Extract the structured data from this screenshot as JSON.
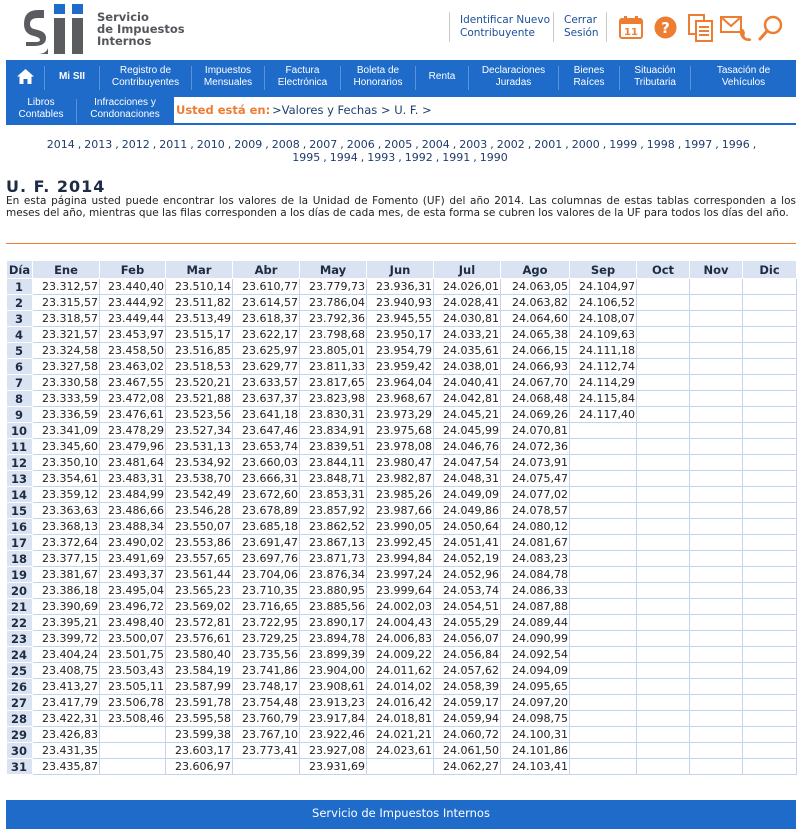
{
  "header": {
    "logo_name": "SII",
    "logo_text": [
      "Servicio",
      "de Impuestos",
      "Internos"
    ],
    "link_identify": [
      "Identificar Nuevo",
      "Contribuyente"
    ],
    "link_logout": [
      "Cerrar",
      "Sesión"
    ],
    "calendar_day": "11",
    "colors": {
      "brand_blue": "#1e6bc9",
      "accent_orange": "#ed7d31"
    }
  },
  "nav": {
    "home_icon": "home-icon",
    "items": [
      {
        "label": [
          "Mi SII"
        ]
      },
      {
        "label": [
          "Registro de",
          "Contribuyentes"
        ]
      },
      {
        "label": [
          "Impuestos",
          "Mensuales"
        ]
      },
      {
        "label": [
          "Factura",
          "Electrónica"
        ]
      },
      {
        "label": [
          "Boleta de",
          "Honorarios"
        ]
      },
      {
        "label": [
          "Renta"
        ]
      },
      {
        "label": [
          "Declaraciones",
          "Juradas"
        ]
      },
      {
        "label": [
          "Bienes",
          "Raíces"
        ]
      },
      {
        "label": [
          "Situación",
          "Tributaria"
        ]
      },
      {
        "label": [
          "Tasación de",
          "Vehículos"
        ]
      }
    ],
    "row2": [
      {
        "label": [
          "Libros",
          "Contables"
        ]
      },
      {
        "label": [
          "Infracciones y",
          "Condonaciones"
        ]
      }
    ]
  },
  "breadcrumb": {
    "label": "Usted está en:",
    "path": ">Valores y Fechas >  U. F. >"
  },
  "years": [
    "2014",
    "2013",
    "2012",
    "2011",
    "2010",
    "2009",
    "2008",
    "2007",
    "2006",
    "2005",
    "2004",
    "2003",
    "2002",
    "2001",
    "2000",
    "1999",
    "1998",
    "1997",
    "1996",
    "1995",
    "1994",
    "1993",
    "1992",
    "1991",
    "1990"
  ],
  "page": {
    "title": "U. F. 2014",
    "description": "En esta página usted puede encontrar los valores de la Unidad de Fomento (UF) del año 2014. Las columnas de estas tablas corresponden a los meses del año, mientras que las filas corresponden a los días de cada mes, de esta forma se cubren los valores de la UF para todos los días del año."
  },
  "table": {
    "headers": [
      "Día",
      "Ene",
      "Feb",
      "Mar",
      "Abr",
      "May",
      "Jun",
      "Jul",
      "Ago",
      "Sep",
      "Oct",
      "Nov",
      "Dic"
    ],
    "rows": [
      [
        "1",
        "23.312,57",
        "23.440,40",
        "23.510,14",
        "23.610,77",
        "23.779,73",
        "23.936,31",
        "24.026,01",
        "24.063,05",
        "24.104,97",
        "",
        "",
        ""
      ],
      [
        "2",
        "23.315,57",
        "23.444,92",
        "23.511,82",
        "23.614,57",
        "23.786,04",
        "23.940,93",
        "24.028,41",
        "24.063,82",
        "24.106,52",
        "",
        "",
        ""
      ],
      [
        "3",
        "23.318,57",
        "23.449,44",
        "23.513,49",
        "23.618,37",
        "23.792,36",
        "23.945,55",
        "24.030,81",
        "24.064,60",
        "24.108,07",
        "",
        "",
        ""
      ],
      [
        "4",
        "23.321,57",
        "23.453,97",
        "23.515,17",
        "23.622,17",
        "23.798,68",
        "23.950,17",
        "24.033,21",
        "24.065,38",
        "24.109,63",
        "",
        "",
        ""
      ],
      [
        "5",
        "23.324,58",
        "23.458,50",
        "23.516,85",
        "23.625,97",
        "23.805,01",
        "23.954,79",
        "24.035,61",
        "24.066,15",
        "24.111,18",
        "",
        "",
        ""
      ],
      [
        "6",
        "23.327,58",
        "23.463,02",
        "23.518,53",
        "23.629,77",
        "23.811,33",
        "23.959,42",
        "24.038,01",
        "24.066,93",
        "24.112,74",
        "",
        "",
        ""
      ],
      [
        "7",
        "23.330,58",
        "23.467,55",
        "23.520,21",
        "23.633,57",
        "23.817,65",
        "23.964,04",
        "24.040,41",
        "24.067,70",
        "24.114,29",
        "",
        "",
        ""
      ],
      [
        "8",
        "23.333,59",
        "23.472,08",
        "23.521,88",
        "23.637,37",
        "23.823,98",
        "23.968,67",
        "24.042,81",
        "24.068,48",
        "24.115,84",
        "",
        "",
        ""
      ],
      [
        "9",
        "23.336,59",
        "23.476,61",
        "23.523,56",
        "23.641,18",
        "23.830,31",
        "23.973,29",
        "24.045,21",
        "24.069,26",
        "24.117,40",
        "",
        "",
        ""
      ],
      [
        "10",
        "23.341,09",
        "23.478,29",
        "23.527,34",
        "23.647,46",
        "23.834,91",
        "23.975,68",
        "24.045,99",
        "24.070,81",
        "",
        "",
        "",
        ""
      ],
      [
        "11",
        "23.345,60",
        "23.479,96",
        "23.531,13",
        "23.653,74",
        "23.839,51",
        "23.978,08",
        "24.046,76",
        "24.072,36",
        "",
        "",
        "",
        ""
      ],
      [
        "12",
        "23.350,10",
        "23.481,64",
        "23.534,92",
        "23.660,03",
        "23.844,11",
        "23.980,47",
        "24.047,54",
        "24.073,91",
        "",
        "",
        "",
        ""
      ],
      [
        "13",
        "23.354,61",
        "23.483,31",
        "23.538,70",
        "23.666,31",
        "23.848,71",
        "23.982,87",
        "24.048,31",
        "24.075,47",
        "",
        "",
        "",
        ""
      ],
      [
        "14",
        "23.359,12",
        "23.484,99",
        "23.542,49",
        "23.672,60",
        "23.853,31",
        "23.985,26",
        "24.049,09",
        "24.077,02",
        "",
        "",
        "",
        ""
      ],
      [
        "15",
        "23.363,63",
        "23.486,66",
        "23.546,28",
        "23.678,89",
        "23.857,92",
        "23.987,66",
        "24.049,86",
        "24.078,57",
        "",
        "",
        "",
        ""
      ],
      [
        "16",
        "23.368,13",
        "23.488,34",
        "23.550,07",
        "23.685,18",
        "23.862,52",
        "23.990,05",
        "24.050,64",
        "24.080,12",
        "",
        "",
        "",
        ""
      ],
      [
        "17",
        "23.372,64",
        "23.490,02",
        "23.553,86",
        "23.691,47",
        "23.867,13",
        "23.992,45",
        "24.051,41",
        "24.081,67",
        "",
        "",
        "",
        ""
      ],
      [
        "18",
        "23.377,15",
        "23.491,69",
        "23.557,65",
        "23.697,76",
        "23.871,73",
        "23.994,84",
        "24.052,19",
        "24.083,23",
        "",
        "",
        "",
        ""
      ],
      [
        "19",
        "23.381,67",
        "23.493,37",
        "23.561,44",
        "23.704,06",
        "23.876,34",
        "23.997,24",
        "24.052,96",
        "24.084,78",
        "",
        "",
        "",
        ""
      ],
      [
        "20",
        "23.386,18",
        "23.495,04",
        "23.565,23",
        "23.710,35",
        "23.880,95",
        "23.999,64",
        "24.053,74",
        "24.086,33",
        "",
        "",
        "",
        ""
      ],
      [
        "21",
        "23.390,69",
        "23.496,72",
        "23.569,02",
        "23.716,65",
        "23.885,56",
        "24.002,03",
        "24.054,51",
        "24.087,88",
        "",
        "",
        "",
        ""
      ],
      [
        "22",
        "23.395,21",
        "23.498,40",
        "23.572,81",
        "23.722,95",
        "23.890,17",
        "24.004,43",
        "24.055,29",
        "24.089,44",
        "",
        "",
        "",
        ""
      ],
      [
        "23",
        "23.399,72",
        "23.500,07",
        "23.576,61",
        "23.729,25",
        "23.894,78",
        "24.006,83",
        "24.056,07",
        "24.090,99",
        "",
        "",
        "",
        ""
      ],
      [
        "24",
        "23.404,24",
        "23.501,75",
        "23.580,40",
        "23.735,56",
        "23.899,39",
        "24.009,22",
        "24.056,84",
        "24.092,54",
        "",
        "",
        "",
        ""
      ],
      [
        "25",
        "23.408,75",
        "23.503,43",
        "23.584,19",
        "23.741,86",
        "23.904,00",
        "24.011,62",
        "24.057,62",
        "24.094,09",
        "",
        "",
        "",
        ""
      ],
      [
        "26",
        "23.413,27",
        "23.505,11",
        "23.587,99",
        "23.748,17",
        "23.908,61",
        "24.014,02",
        "24.058,39",
        "24.095,65",
        "",
        "",
        "",
        ""
      ],
      [
        "27",
        "23.417,79",
        "23.506,78",
        "23.591,78",
        "23.754,48",
        "23.913,23",
        "24.016,42",
        "24.059,17",
        "24.097,20",
        "",
        "",
        "",
        ""
      ],
      [
        "28",
        "23.422,31",
        "23.508,46",
        "23.595,58",
        "23.760,79",
        "23.917,84",
        "24.018,81",
        "24.059,94",
        "24.098,75",
        "",
        "",
        "",
        ""
      ],
      [
        "29",
        "23.426,83",
        "",
        "23.599,38",
        "23.767,10",
        "23.922,46",
        "24.021,21",
        "24.060,72",
        "24.100,31",
        "",
        "",
        "",
        ""
      ],
      [
        "30",
        "23.431,35",
        "",
        "23.603,17",
        "23.773,41",
        "23.927,08",
        "24.023,61",
        "24.061,50",
        "24.101,86",
        "",
        "",
        "",
        ""
      ],
      [
        "31",
        "23.435,87",
        "",
        "23.606,97",
        "",
        "23.931,69",
        "",
        "24.062,27",
        "24.103,41",
        "",
        "",
        "",
        ""
      ]
    ]
  },
  "footer": {
    "text": "Servicio de Impuestos Internos"
  }
}
